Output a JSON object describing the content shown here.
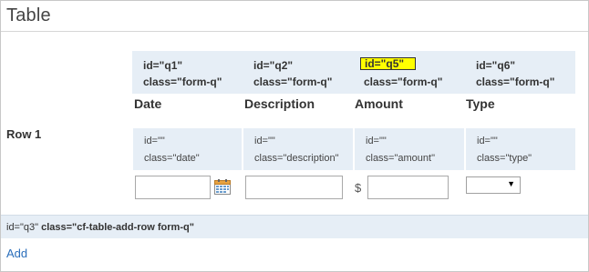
{
  "header": {
    "title": "Table"
  },
  "columns": [
    {
      "id_label": "id=\"q1\"",
      "class_label": "class=\"form-q\"",
      "heading": "Date",
      "field_id": "id=\"\"",
      "field_class": "class=\"date\""
    },
    {
      "id_label": "id=\"q2\"",
      "class_label": "class=\"form-q\"",
      "heading": "Description",
      "field_id": "id=\"\"",
      "field_class": "class=\"description\""
    },
    {
      "id_label": "id=\"q5\"",
      "class_label": "class=\"form-q\"",
      "heading": "Amount",
      "field_id": "id=\"\"",
      "field_class": "class=\"amount\""
    },
    {
      "id_label": "id=\"q6\"",
      "class_label": "class=\"form-q\"",
      "heading": "Type",
      "field_id": "id=\"\"",
      "field_class": "class=\"type\""
    }
  ],
  "row": {
    "label": "Row 1",
    "currency_symbol": "$",
    "date_value": "",
    "description_value": "",
    "amount_value": "",
    "type_value": ""
  },
  "footer": {
    "id_text": "id=\"q3\"",
    "class_text": "class=\"cf-table-add-row form-q\""
  },
  "actions": {
    "add_label": "Add"
  },
  "colors": {
    "highlight": "#ffff00",
    "panel_bg": "#e6eef6",
    "link": "#2a6ebb"
  },
  "icons": {
    "date_picker": "calendar-icon",
    "select_arrow": "triangle-down-icon"
  }
}
